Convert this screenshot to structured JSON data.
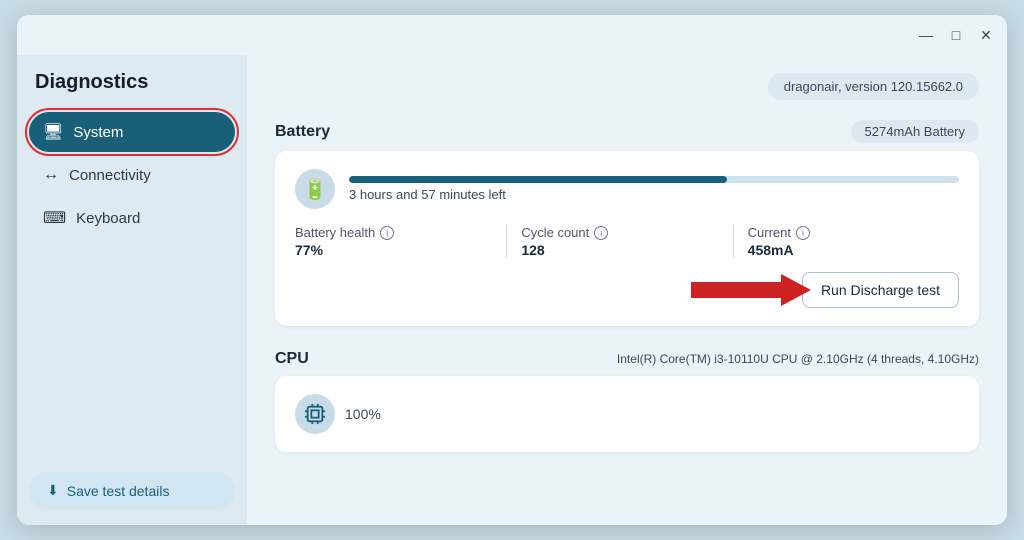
{
  "window": {
    "title": "Diagnostics",
    "titlebar": {
      "minimize": "—",
      "maximize": "□",
      "close": "✕"
    }
  },
  "sidebar": {
    "title": "Diagnostics",
    "items": [
      {
        "id": "system",
        "label": "System",
        "icon": "🖥",
        "active": true
      },
      {
        "id": "connectivity",
        "label": "Connectivity",
        "icon": "↔",
        "active": false
      },
      {
        "id": "keyboard",
        "label": "Keyboard",
        "icon": "⌨",
        "active": false
      }
    ],
    "save_button": "Save test details"
  },
  "main": {
    "version": "dragonair, version 120.15662.0",
    "battery": {
      "section_title": "Battery",
      "section_badge": "5274mAh Battery",
      "time_left": "3 hours and 57 minutes left",
      "bar_percent": 62,
      "stats": [
        {
          "label": "Battery health",
          "value": "77%",
          "has_info": true
        },
        {
          "label": "Cycle count",
          "value": "128",
          "has_info": true
        },
        {
          "label": "Current",
          "value": "458mA",
          "has_info": true
        }
      ],
      "run_btn": "Run Discharge test"
    },
    "cpu": {
      "section_title": "CPU",
      "cpu_info": "Intel(R) Core(TM) i3-10110U CPU @ 2.10GHz (4 threads, 4.10GHz)",
      "percent": "100%"
    }
  }
}
